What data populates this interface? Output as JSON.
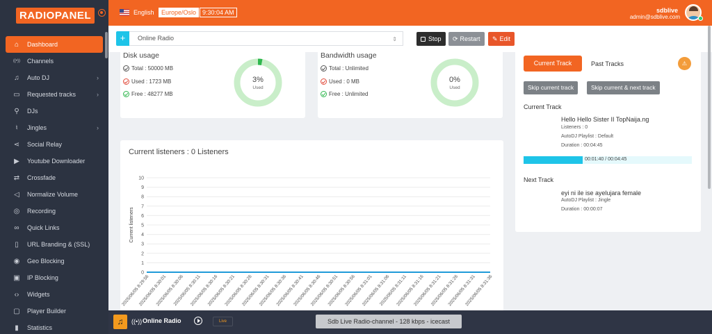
{
  "brand": {
    "logo_radio": "RADIO",
    "logo_panel": "PANEL"
  },
  "sidebar": {
    "items": [
      {
        "label": "Dashboard",
        "icon": "home-icon",
        "active": true,
        "arrow": false
      },
      {
        "label": "Channels",
        "icon": "radio-icon",
        "arrow": false
      },
      {
        "label": "Auto DJ",
        "icon": "music-note-icon",
        "arrow": true
      },
      {
        "label": "Requested tracks",
        "icon": "folder-icon",
        "arrow": true
      },
      {
        "label": "DJs",
        "icon": "user-plus-icon",
        "arrow": false
      },
      {
        "label": "Jingles",
        "icon": "microphone-icon",
        "arrow": true
      },
      {
        "label": "Social Relay",
        "icon": "share-icon",
        "arrow": false
      },
      {
        "label": "Youtube Downloader",
        "icon": "youtube-icon",
        "arrow": false
      },
      {
        "label": "Crossfade",
        "icon": "repeat-icon",
        "arrow": false
      },
      {
        "label": "Normalize Volume",
        "icon": "volume-icon",
        "arrow": false
      },
      {
        "label": "Recording",
        "icon": "record-icon",
        "arrow": false
      },
      {
        "label": "Quick Links",
        "icon": "link-icon",
        "arrow": false
      },
      {
        "label": "URL Branding & (SSL)",
        "icon": "bookmark-icon",
        "arrow": false
      },
      {
        "label": "Geo Blocking",
        "icon": "map-pin-icon",
        "arrow": false
      },
      {
        "label": "IP Blocking",
        "icon": "lock-icon",
        "arrow": false
      },
      {
        "label": "Widgets",
        "icon": "code-icon",
        "arrow": false
      },
      {
        "label": "Player Builder",
        "icon": "chat-icon",
        "arrow": false
      },
      {
        "label": "Statistics",
        "icon": "bar-chart-icon",
        "arrow": false
      }
    ]
  },
  "topbar": {
    "language": "English",
    "timezone": "Europe/Oslo",
    "time": "9:30:04 AM",
    "username": "sdblive",
    "email": "admin@sdblive.com"
  },
  "station": {
    "add_label": "+",
    "selected": "Online Radio",
    "stop_label": "Stop",
    "restart_label": "Restart",
    "edit_label": "Edit"
  },
  "disk": {
    "title": "Disk usage",
    "total": "Total : 50000 MB",
    "used": "Used : 1723 MB",
    "free": "Free : 48277 MB",
    "percent_label": "3%",
    "percent_sub": "Used",
    "percent": 3
  },
  "bandwidth": {
    "title": "Bandwidth usage",
    "total": "Total : Unlimited",
    "used": "Used : 0 MB",
    "free": "Free : Unlimited",
    "percent_label": "0%",
    "percent_sub": "Used",
    "percent": 0
  },
  "colors": {
    "accent": "#f26522",
    "cyan": "#1ec4e8",
    "donut_bg": "#c9eec9",
    "donut_fill": "#2fb74e",
    "line": "#1e9ad8"
  },
  "chart_data": {
    "type": "line",
    "title": "Current listeners : 0 Listeners",
    "ylabel": "Current listeners",
    "xlabel": "",
    "ylim": [
      0,
      10
    ],
    "yticks": [
      0,
      1,
      2,
      3,
      4,
      5,
      6,
      7,
      8,
      9,
      10
    ],
    "x": [
      "2025/06/05 8:29:56",
      "2025/06/05 8:30:01",
      "2025/06/05 8:30:06",
      "2025/06/05 8:30:11",
      "2025/06/05 8:30:16",
      "2025/06/05 8:30:21",
      "2025/06/05 8:30:26",
      "2025/06/05 8:30:31",
      "2025/06/05 8:30:36",
      "2025/06/05 8:30:41",
      "2025/06/05 8:30:46",
      "2025/06/05 8:30:51",
      "2025/06/05 8:30:56",
      "2025/06/05 8:31:01",
      "2025/06/05 8:31:06",
      "2025/06/05 8:31:11",
      "2025/06/05 8:31:16",
      "2025/06/05 8:31:21",
      "2025/06/05 8:31:26",
      "2025/06/05 8:31:31",
      "2025/06/05 8:31:36"
    ],
    "series": [
      {
        "values": [
          0,
          0,
          0,
          0,
          0,
          0,
          0,
          0,
          0,
          0,
          0,
          0,
          0,
          0,
          0,
          0,
          0,
          0,
          0,
          0,
          0
        ]
      }
    ]
  },
  "tracks": {
    "tab_current": "Current Track",
    "tab_past": "Past Tracks",
    "skip_current": "Skip current track",
    "skip_current_next": "Skip current & next track",
    "current_heading": "Current Track",
    "current_title": "Hello Hello Sister II TopNaija.ng",
    "current_listeners": "Listeners : 0",
    "current_playlist": "AutoDJ Playlist : Default",
    "current_duration": "Duration : 00:04:45",
    "progress_text": "00:01:40 / 00:04:45",
    "progress": 0.351,
    "next_heading": "Next Track",
    "next_title": "eyi ni ile ise ayelujara female",
    "next_playlist": "AutoDJ Playlist : Jingle",
    "next_duration": "Duration : 00:00:07"
  },
  "player": {
    "name": "Online Radio",
    "live": "Live",
    "info": "Sdb Live Radio-channel - 128 kbps - icecast"
  }
}
